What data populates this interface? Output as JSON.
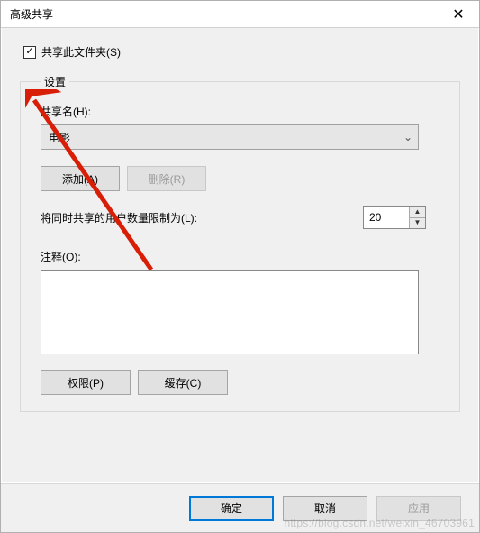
{
  "titlebar": {
    "title": "高级共享"
  },
  "share_checkbox": {
    "label": "共享此文件夹(S)",
    "checked": true
  },
  "group": {
    "legend": "设置",
    "share_name_label": "共享名(H):",
    "share_name_value": "电影",
    "add_btn": "添加(A)",
    "remove_btn": "删除(R)",
    "limit_label": "将同时共享的用户数量限制为(L):",
    "limit_value": "20",
    "comment_label": "注释(O):",
    "comment_value": "",
    "perm_btn": "权限(P)",
    "cache_btn": "缓存(C)"
  },
  "footer": {
    "ok": "确定",
    "cancel": "取消",
    "apply": "应用"
  },
  "watermark": "https://blog.csdn.net/weixin_46703961"
}
